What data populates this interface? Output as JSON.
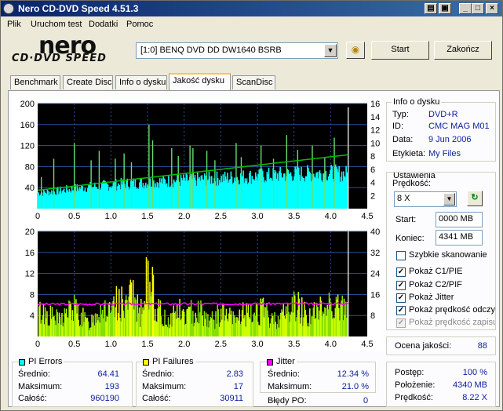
{
  "window": {
    "title": "Nero CD-DVD Speed 4.51.3"
  },
  "menu": [
    "Plik",
    "Uruchom test",
    "Dodatki",
    "Pomoc"
  ],
  "logo": {
    "top": "nero",
    "bottom": "CD·DVD SPEED"
  },
  "drive": {
    "selected": "[1:0]  BENQ DVD DD DW1640 BSRB"
  },
  "buttons": {
    "start": "Start",
    "close": "Zakończ"
  },
  "tabs": [
    "Benchmark",
    "Create Disc",
    "Info o dysku",
    "Jakość dysku",
    "ScanDisc"
  ],
  "active_tab": "Jakość dysku",
  "disc_info": {
    "title": "Info o dysku",
    "rows": [
      {
        "label": "Typ:",
        "value": "DVD+R"
      },
      {
        "label": "ID:",
        "value": "CMC MAG M01"
      },
      {
        "label": "Data:",
        "value": "9 Jun 2006"
      },
      {
        "label": "Etykieta:",
        "value": "My Files"
      }
    ]
  },
  "settings": {
    "title": "Ustawienia",
    "speed_label": "Prędkość:",
    "speed_value": "8 X",
    "start_label": "Start:",
    "start_value": "0000 MB",
    "end_label": "Koniec:",
    "end_value": "4341 MB",
    "checkboxes": [
      {
        "label": "Szybkie skanowanie",
        "checked": false,
        "enabled": true
      },
      {
        "label": "Pokaż C1/PIE",
        "checked": true,
        "enabled": true
      },
      {
        "label": "Pokaż C2/PIF",
        "checked": true,
        "enabled": true
      },
      {
        "label": "Pokaż Jitter",
        "checked": true,
        "enabled": true
      },
      {
        "label": "Pokaż prędkość odczytu",
        "checked": true,
        "enabled": true
      },
      {
        "label": "Pokaż prędkość zapisu",
        "checked": true,
        "enabled": false
      }
    ],
    "check_mark": "✓"
  },
  "quality": {
    "label": "Ocena jakości:",
    "value": "88"
  },
  "pi_errors": {
    "title": "PI Errors",
    "color": "#00FFFF",
    "rows": [
      {
        "label": "Średnio:",
        "value": "64.41"
      },
      {
        "label": "Maksimum:",
        "value": "193"
      },
      {
        "label": "Całość:",
        "value": "960190"
      }
    ]
  },
  "pi_failures": {
    "title": "PI Failures",
    "color": "#FFFF00",
    "rows": [
      {
        "label": "Średnio:",
        "value": "2.83"
      },
      {
        "label": "Maksimum:",
        "value": "17"
      },
      {
        "label": "Całość:",
        "value": "30911"
      }
    ]
  },
  "jitter": {
    "title": "Jitter",
    "color": "#FF00FF",
    "rows": [
      {
        "label": "Średnio:",
        "value": "12.34 %"
      },
      {
        "label": "Maksimum:",
        "value": "21.0 %"
      }
    ],
    "po_label": "Błędy PO:",
    "po_value": "0"
  },
  "progress": {
    "rows": [
      {
        "label": "Postęp:",
        "value": "100 %"
      },
      {
        "label": "Położenie:",
        "value": "4340 MB"
      },
      {
        "label": "Prędkość:",
        "value": "8.22 X"
      }
    ]
  },
  "chart_data": [
    {
      "type": "bar",
      "title": "PI Errors",
      "x_ticks": [
        "0",
        "0.5",
        "1.0",
        "1.5",
        "2.0",
        "2.5",
        "3.0",
        "3.5",
        "4.0",
        "4.5"
      ],
      "xlim": [
        0,
        4.5
      ],
      "y_left_ticks": [
        "200",
        "160",
        "120",
        "80",
        "40"
      ],
      "ylim": [
        0,
        200
      ],
      "y_right_ticks": [
        "16",
        "14",
        "12",
        "10",
        "8",
        "6",
        "4",
        "2"
      ],
      "y2lim": [
        0,
        16
      ],
      "data_end": 4.24,
      "series": [
        {
          "name": "PI Errors",
          "color": "#00FFFF",
          "x": [
            0,
            0.25,
            0.5,
            0.75,
            1.0,
            1.25,
            1.5,
            1.75,
            2.0,
            2.25,
            2.5,
            2.75,
            3.0,
            3.25,
            3.5,
            3.75,
            4.0,
            4.24
          ],
          "values": [
            30,
            33,
            38,
            42,
            45,
            48,
            50,
            52,
            54,
            56,
            58,
            60,
            62,
            64,
            66,
            67,
            68,
            66
          ]
        },
        {
          "name": "Read speed",
          "color": "#00C000",
          "x": [
            0,
            4.24
          ],
          "values": [
            2.8,
            8.2
          ]
        }
      ],
      "spikes": {
        "color": "#66E070",
        "x": [
          0.05,
          0.22,
          0.5,
          0.73,
          0.84,
          1.06,
          1.18,
          1.28,
          1.52,
          1.57,
          1.83,
          1.92,
          2.08,
          2.12,
          2.31,
          2.42,
          2.71,
          2.78,
          3.05,
          3.22,
          3.4,
          3.55,
          3.75,
          3.92,
          4.05,
          4.24
        ],
        "values": [
          60,
          95,
          125,
          92,
          110,
          95,
          105,
          88,
          160,
          130,
          115,
          100,
          120,
          115,
          110,
          92,
          125,
          98,
          120,
          95,
          140,
          112,
          120,
          98,
          135,
          193
        ]
      }
    },
    {
      "type": "bar",
      "title": "PI Failures / Jitter",
      "x_ticks": [
        "0",
        "0.5",
        "1.0",
        "1.5",
        "2.0",
        "2.5",
        "3.0",
        "3.5",
        "4.0",
        "4.5"
      ],
      "xlim": [
        0,
        4.5
      ],
      "y_left_ticks": [
        "20",
        "16",
        "12",
        "8",
        "4"
      ],
      "ylim": [
        0,
        20
      ],
      "y_right_ticks": [
        "40",
        "32",
        "24",
        "16",
        "8"
      ],
      "y2lim": [
        0,
        40
      ],
      "data_end": 4.24,
      "series": [
        {
          "name": "PI Failures",
          "color": "#CCFF00",
          "x": [
            0.1,
            0.2,
            0.3,
            0.4,
            0.5,
            0.6,
            0.7,
            0.8,
            0.9,
            1.0,
            1.1,
            1.2,
            1.3,
            1.4,
            1.5,
            1.55,
            1.6,
            1.7,
            1.8,
            1.9,
            2.0,
            2.1,
            2.2,
            2.3,
            2.4,
            2.5,
            2.6,
            2.7,
            2.8,
            2.9,
            3.0,
            3.1,
            3.2,
            3.3,
            3.4,
            3.5,
            3.6,
            3.7,
            3.8,
            3.9,
            4.0,
            4.1,
            4.2
          ],
          "values": [
            6,
            5,
            4,
            6,
            7,
            5,
            3,
            6,
            8,
            5,
            9,
            7,
            10,
            6,
            14,
            17,
            8,
            5,
            4,
            7,
            5,
            6,
            7,
            5,
            4,
            6,
            5,
            4,
            6,
            5,
            7,
            6,
            4,
            5,
            6,
            8,
            7,
            5,
            6,
            7,
            9,
            8,
            6
          ]
        },
        {
          "name": "Jitter",
          "color": "#FF00FF",
          "x": [
            0,
            4.24
          ],
          "values": [
            12.3,
            12.5
          ]
        }
      ]
    }
  ]
}
